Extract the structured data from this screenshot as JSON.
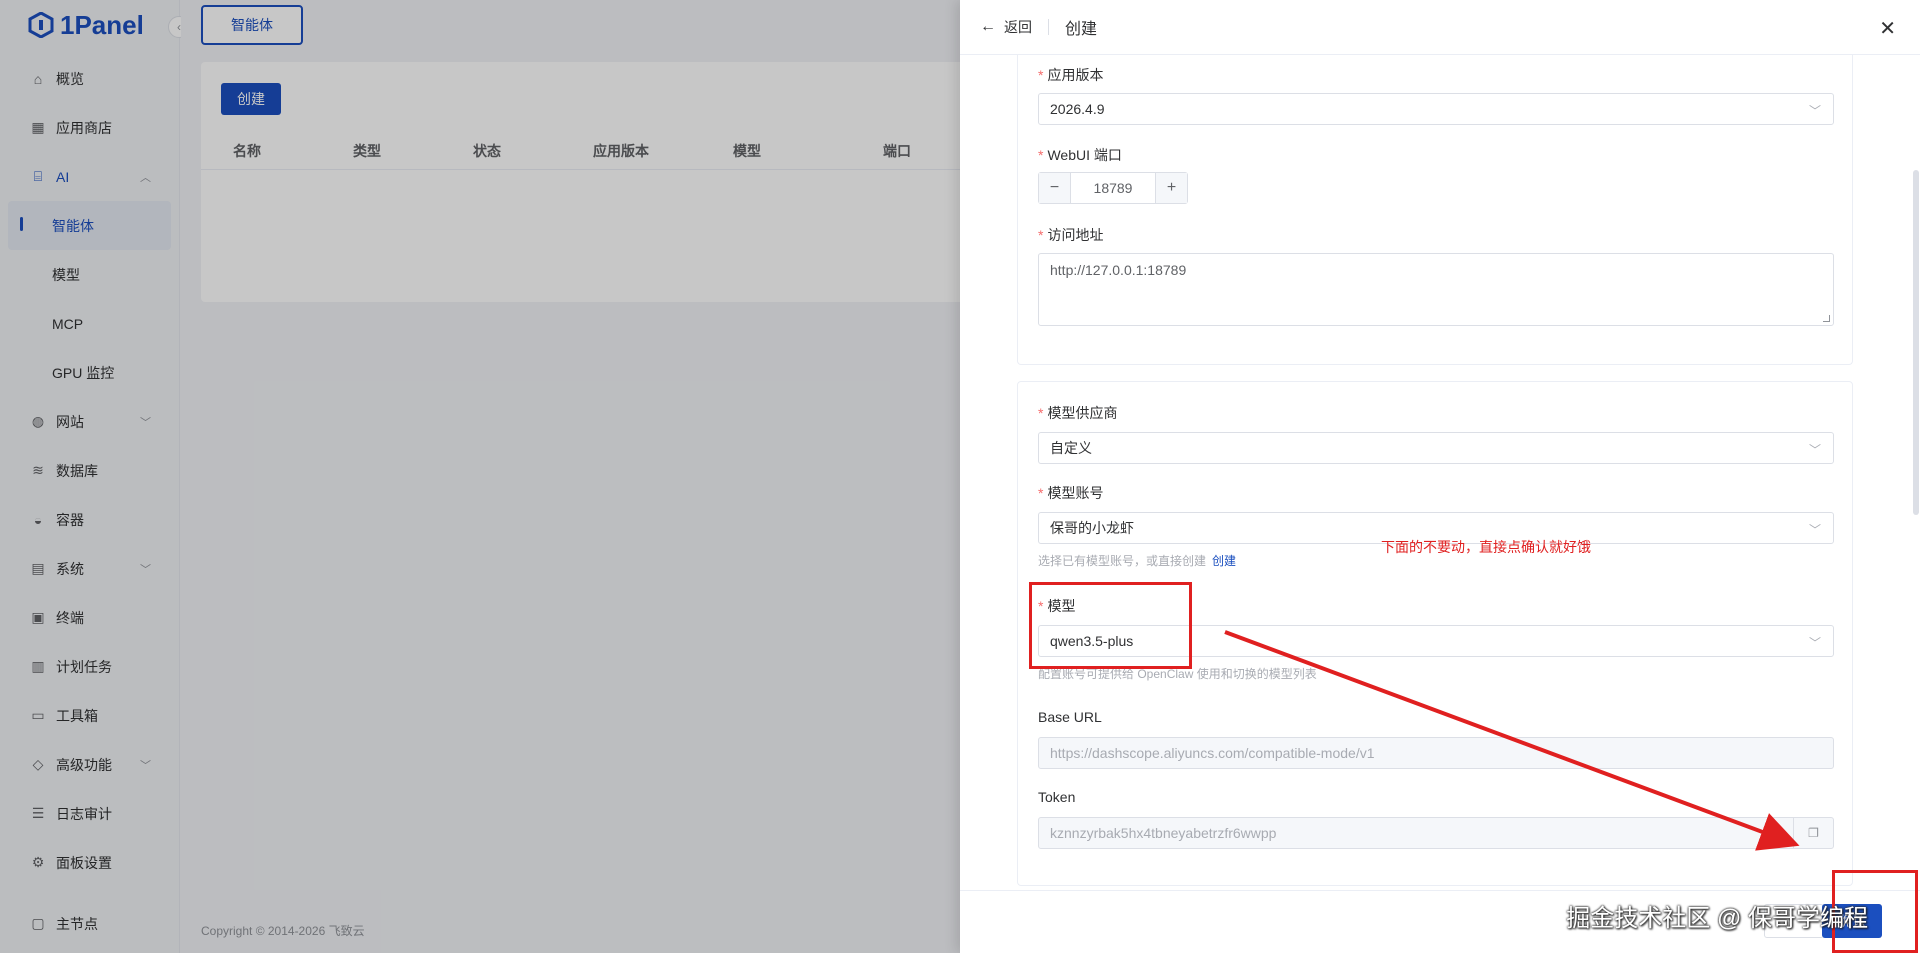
{
  "app": {
    "logo_text": "1Panel",
    "accent": "#1b4fbf"
  },
  "sidebar": {
    "items": [
      {
        "label": "概览",
        "icon": "home-icon"
      },
      {
        "label": "应用商店",
        "icon": "grid-icon"
      },
      {
        "label": "AI",
        "icon": "robot-icon"
      },
      {
        "label": "智能体",
        "icon": ""
      },
      {
        "label": "模型",
        "icon": ""
      },
      {
        "label": "MCP",
        "icon": ""
      },
      {
        "label": "GPU 监控",
        "icon": ""
      },
      {
        "label": "网站",
        "icon": "globe-icon"
      },
      {
        "label": "数据库",
        "icon": "database-icon"
      },
      {
        "label": "容器",
        "icon": "docker-icon"
      },
      {
        "label": "系统",
        "icon": "server-icon"
      },
      {
        "label": "终端",
        "icon": "terminal-icon"
      },
      {
        "label": "计划任务",
        "icon": "calendar-icon"
      },
      {
        "label": "工具箱",
        "icon": "toolbox-icon"
      },
      {
        "label": "高级功能",
        "icon": "diamond-icon"
      },
      {
        "label": "日志审计",
        "icon": "log-icon"
      },
      {
        "label": "面板设置",
        "icon": "gear-icon"
      },
      {
        "label": "主节点",
        "icon": "monitor-icon"
      }
    ]
  },
  "main": {
    "tab_label": "智能体",
    "create_label": "创建",
    "columns": [
      "名称",
      "类型",
      "状态",
      "应用版本",
      "模型",
      "端口"
    ],
    "footer": "Copyright © 2014-2026 飞致云"
  },
  "drawer": {
    "back_label": "返回",
    "title": "创建",
    "app_version": {
      "label": "应用版本",
      "value": "2026.4.9"
    },
    "webui_port": {
      "label": "WebUI 端口",
      "value": "18789"
    },
    "access_url": {
      "label": "访问地址",
      "value": "http://127.0.0.1:18789"
    },
    "provider": {
      "label": "模型供应商",
      "value": "自定义"
    },
    "account": {
      "label": "模型账号",
      "value": "保哥的小龙虾",
      "hint": "选择已有模型账号，或直接创建",
      "hint_link": "创建"
    },
    "model": {
      "label": "模型",
      "value": "qwen3.5-plus",
      "hint": "配置账号可提供给 OpenClaw 使用和切换的模型列表"
    },
    "base_url": {
      "label": "Base URL",
      "value": "https://dashscope.aliyuncs.com/compatible-mode/v1"
    },
    "token": {
      "label": "Token",
      "value": "kznnzyrbak5hx4tbneyabetrzfr6wwpp"
    },
    "confirm_label": "确认"
  },
  "annotation": {
    "text": "下面的不要动，直接点确认就好饿",
    "color": "#e02020"
  },
  "watermark": "掘金技术社区 @ 保哥学编程"
}
